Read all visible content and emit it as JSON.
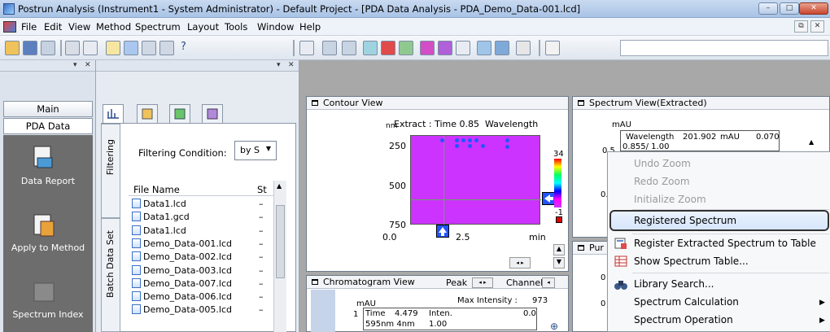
{
  "window": {
    "title": "Postrun Analysis (Instrument1 - System Administrator) - Default Project - [PDA Data Analysis - PDA_Demo_Data-001.lcd]",
    "min": "–",
    "max": "□",
    "close": "✕"
  },
  "menu": {
    "items": [
      "File",
      "Edit",
      "View",
      "Method",
      "Spectrum",
      "Layout",
      "Tools",
      "Window",
      "Help"
    ],
    "mdi_restore": "⧉",
    "mdi_close": "✕"
  },
  "toolbar": {
    "help": "?"
  },
  "nav": {
    "tabs": [
      "Main",
      "PDA Data"
    ],
    "items": [
      "Data Report",
      "Apply to Method",
      "Spectrum Index"
    ]
  },
  "file_panel": {
    "vtabs": [
      "Filtering",
      "Batch Data Set"
    ],
    "filter_label": "Filtering Condition:",
    "filter_value": "by S",
    "col_file": "File Name",
    "col_status": "St",
    "files": [
      {
        "name": "Data1.lcd",
        "status": "–"
      },
      {
        "name": "Data1.gcd",
        "status": "–"
      },
      {
        "name": "Data1.lcd",
        "status": "–"
      },
      {
        "name": "Demo_Data-001.lcd",
        "status": "–"
      },
      {
        "name": "Demo_Data-002.lcd",
        "status": "–"
      },
      {
        "name": "Demo_Data-003.lcd",
        "status": "–"
      },
      {
        "name": "Demo_Data-007.lcd",
        "status": "–"
      },
      {
        "name": "Demo_Data-006.lcd",
        "status": "–"
      },
      {
        "name": "Demo_Data-005.lcd",
        "status": "–"
      }
    ]
  },
  "contour": {
    "title": "Contour View",
    "extract": "Extract : Time 0.85",
    "wavelength": "Wavelength",
    "unit_nm": "nm",
    "y_ticks": [
      "250",
      "500",
      "750"
    ],
    "x_ticks": [
      "0.0",
      "2.5",
      "min"
    ],
    "cbar_top": "34",
    "cbar_bottom": "-1"
  },
  "spectrum": {
    "title": "Spectrum View(Extracted)",
    "unit": "mAU",
    "wl_label": "Wavelength",
    "wl_value": "201.902",
    "mau_label": "mAU",
    "mau_value": "0.070",
    "time_row": "0.855/ 1.00",
    "y_tick1": "0.5",
    "y_tick2": "0."
  },
  "chromatogram": {
    "title": "Chromatogram View",
    "peak_label": "Peak",
    "channel_label": "Channel",
    "unit": "mAU",
    "max_intensity_label": "Max Intensity :",
    "max_intensity_value": "973",
    "time_label": "Time",
    "time_value": "4.479",
    "inten_label": "Inten.",
    "inten_value": "0.0",
    "row2": "595nm 4nm",
    "row2_value": "1.00",
    "y_tick": "1"
  },
  "pu_window": {
    "title": "Pur",
    "tick": "0"
  },
  "context_menu": {
    "items": [
      {
        "label": "Undo Zoom",
        "enabled": false
      },
      {
        "label": "Redo Zoom",
        "enabled": false
      },
      {
        "label": "Initialize Zoom",
        "enabled": false
      },
      {
        "label": "Registered Spectrum",
        "enabled": true,
        "highlighted": true
      },
      {
        "label": "Register Extracted Spectrum to Table",
        "enabled": true
      },
      {
        "label": "Show Spectrum Table...",
        "enabled": true
      },
      {
        "label": "Library Search...",
        "enabled": true
      },
      {
        "label": "Spectrum Calculation",
        "enabled": true,
        "submenu": true
      },
      {
        "label": "Spectrum Operation",
        "enabled": true,
        "submenu": true
      }
    ]
  },
  "colors": {
    "contour_bg": "#cc33ff",
    "accent_blue": "#2255ff",
    "nav_body": "#6d6d6d"
  },
  "icons": [
    "table-icon",
    "register-icon",
    "binoculars-icon",
    "submenu-arrow-icon"
  ]
}
